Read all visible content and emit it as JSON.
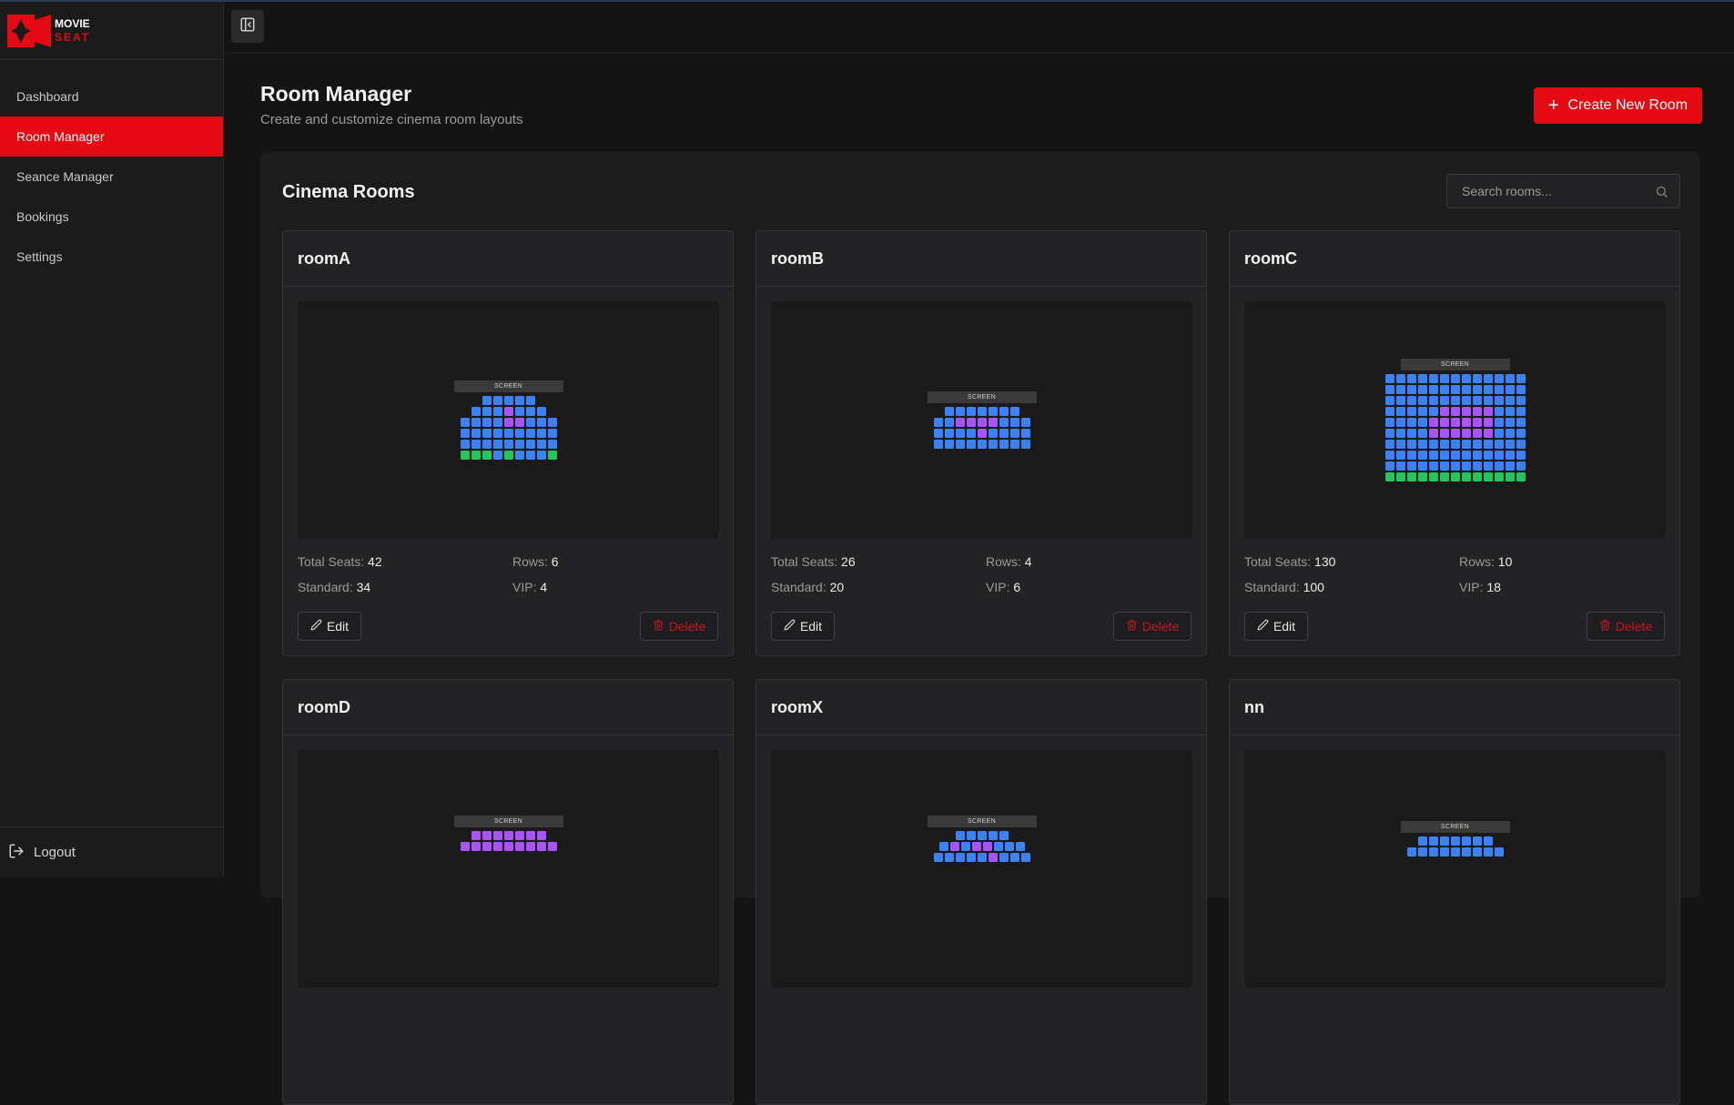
{
  "brand": {
    "line1": "MOVIE",
    "line2": "SEAT"
  },
  "sidebar": {
    "items": [
      {
        "label": "Dashboard",
        "active": false
      },
      {
        "label": "Room Manager",
        "active": true
      },
      {
        "label": "Seance Manager",
        "active": false
      },
      {
        "label": "Bookings",
        "active": false
      },
      {
        "label": "Settings",
        "active": false
      }
    ],
    "logout_label": "Logout"
  },
  "header": {
    "title": "Room Manager",
    "subtitle": "Create and customize cinema room layouts",
    "create_button": "Create New Room"
  },
  "panel": {
    "title": "Cinema Rooms",
    "search_placeholder": "Search rooms..."
  },
  "labels": {
    "total_seats": "Total Seats:",
    "rows": "Rows:",
    "standard": "Standard:",
    "vip": "VIP:",
    "edit": "Edit",
    "delete": "Delete",
    "screen": "SCREEN"
  },
  "colors": {
    "accent": "#e50914",
    "standard_seat": "#3b82f6",
    "vip_seat": "#a855f7",
    "accessible_seat": "#22c55e"
  },
  "rooms": [
    {
      "name": "roomA",
      "total_seats": "42",
      "rows": "6",
      "standard": "34",
      "vip": "4",
      "layout": [
        "__sssss__",
        "_sssvsss_",
        "ssssvvsss",
        "sssssssss",
        "sssssssss",
        "aaasasssa"
      ]
    },
    {
      "name": "roomB",
      "total_seats": "26",
      "rows": "4",
      "standard": "20",
      "vip": "6",
      "layout": [
        "_sssssss_",
        "ssvvvvsss",
        "ssssvssss",
        "sssssssss"
      ]
    },
    {
      "name": "roomC",
      "total_seats": "130",
      "rows": "10",
      "standard": "100",
      "vip": "18",
      "layout": [
        "sssssssssssss",
        "sssssssssssss",
        "sssssssssssss",
        "sssssvvvvvsss",
        "ssssvvvvvvsss",
        "ssssvvvvvvsss",
        "sssssssssssss",
        "sssssssssssss",
        "sssssssssssss",
        "aaaaaaaaaaaaa"
      ]
    },
    {
      "name": "roomD",
      "total_seats": "",
      "rows": "",
      "standard": "",
      "vip": "",
      "layout": [
        "_vvvvvvv_",
        "vvvvvvvvv"
      ]
    },
    {
      "name": "roomX",
      "total_seats": "",
      "rows": "",
      "standard": "",
      "vip": "",
      "layout": [
        "__sssss__",
        "_svsvvsss_",
        "sssssvsss"
      ]
    },
    {
      "name": "nn",
      "total_seats": "",
      "rows": "",
      "standard": "",
      "vip": "",
      "layout": [
        "_sssssss_",
        "sssssssss"
      ]
    }
  ]
}
